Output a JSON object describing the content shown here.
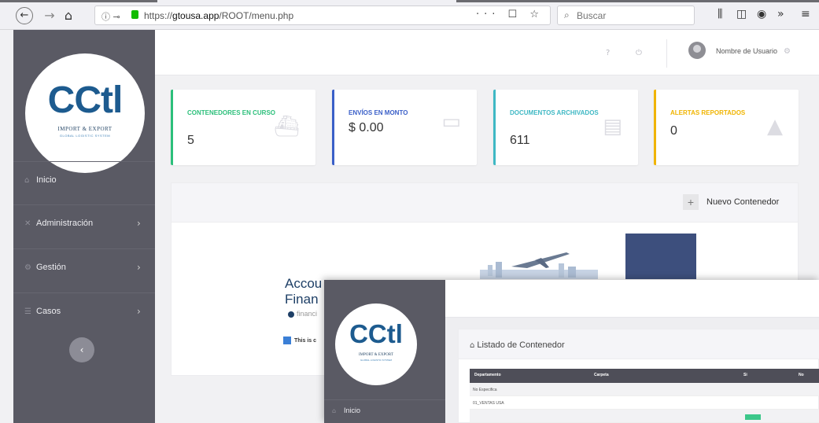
{
  "browser": {
    "url_prefix": "https://",
    "url_domain": "gtousa.app",
    "url_path": "/ROOT/menu.php",
    "search_placeholder": "Buscar",
    "page_actions": "··· ☐ ☆"
  },
  "logo": {
    "text": "CCtl",
    "subtitle": "IMPORT & EXPORT",
    "tagline": "GLOBAL LOGISTIC SYSTEM"
  },
  "sidebar": {
    "items": [
      {
        "label": "Inicio",
        "icon": "home-icon",
        "has_submenu": false
      },
      {
        "label": "Administración",
        "icon": "tools-icon",
        "has_submenu": true
      },
      {
        "label": "Gestión",
        "icon": "gears-icon",
        "has_submenu": true
      },
      {
        "label": "Casos",
        "icon": "list-icon",
        "has_submenu": true
      }
    ]
  },
  "header": {
    "user_name": "Nombre de Usuario"
  },
  "cards": [
    {
      "label": "CONTENEDORES EN CURSO",
      "value": "5",
      "color": "#2bbf7a",
      "icon": "ship-icon"
    },
    {
      "label": "ENVÍOS EN MONTO",
      "value": "$ 0.00",
      "color": "#3a5fc8",
      "icon": "money-icon"
    },
    {
      "label": "DOCUMENTOS ARCHIVADOS",
      "value": "611",
      "color": "#3fb8c4",
      "icon": "archive-icon"
    },
    {
      "label": "ALERTAS REPORTADOS",
      "value": "0",
      "color": "#f0b400",
      "icon": "warning-icon"
    }
  ],
  "panel": {
    "new_button_label": "Nuevo Contenedor",
    "hero_title_line1": "Accou",
    "hero_title_line2": "Finan",
    "hero_sub": "financi",
    "hero_note": "This is c"
  },
  "overlay": {
    "sidebar_item": "Inicio",
    "card_title": "Listado de Contenedor",
    "table_headers": [
      "Departamento",
      "Carpeta",
      "Si",
      "No"
    ],
    "rows": [
      "No Especifica",
      "01_VENTAS USA"
    ]
  }
}
